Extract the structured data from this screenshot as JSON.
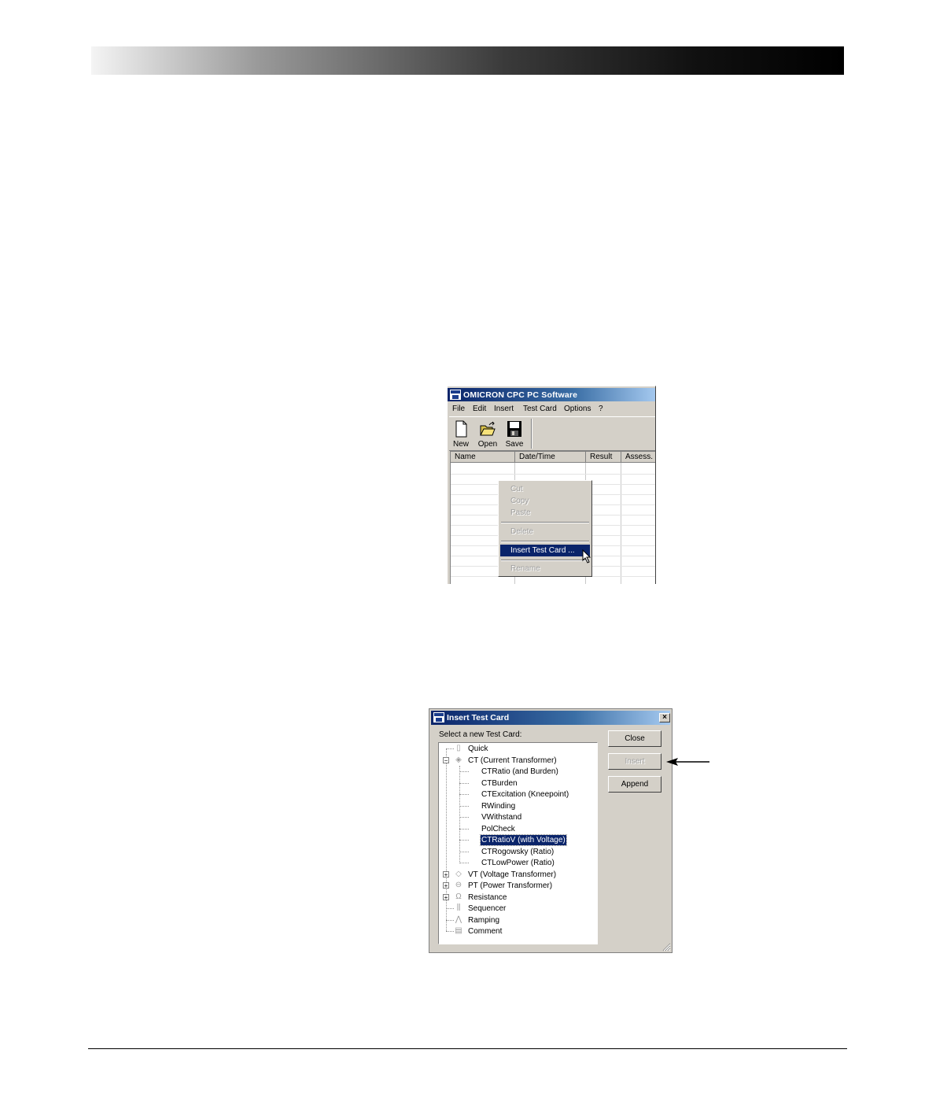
{
  "window": {
    "title": "OMICRON CPC PC Software",
    "menu": [
      "File",
      "Edit",
      "Insert",
      "Test Card",
      "Options",
      "?"
    ],
    "toolbar": {
      "new": "New",
      "open": "Open",
      "save": "Save"
    },
    "columns": [
      "Name",
      "Date/Time",
      "Result",
      "Assess."
    ]
  },
  "context_menu": {
    "cut": "Cut",
    "copy": "Copy",
    "paste": "Paste",
    "delete": "Delete",
    "insert_test_card": "Insert Test Card ...",
    "rename": "Rename"
  },
  "dialog": {
    "title": "Insert Test Card",
    "close_x": "×",
    "prompt": "Select a new Test Card:",
    "tree": {
      "quick": "Quick",
      "ct": "CT (Current Transformer)",
      "ct_children": [
        "CTRatio (and Burden)",
        "CTBurden",
        "CTExcitation (Kneepoint)",
        "RWinding",
        "VWithstand",
        "PolCheck",
        "CTRatioV (with Voltage)",
        "CTRogowsky (Ratio)",
        "CTLowPower (Ratio)"
      ],
      "vt": "VT (Voltage Transformer)",
      "pt": "PT (Power Transformer)",
      "resistance": "Resistance",
      "sequencer": "Sequencer",
      "ramping": "Ramping",
      "comment": "Comment"
    },
    "selected_item": "CTRatioV (with Voltage)",
    "buttons": {
      "close": "Close",
      "insert": "Insert",
      "append": "Append"
    }
  }
}
